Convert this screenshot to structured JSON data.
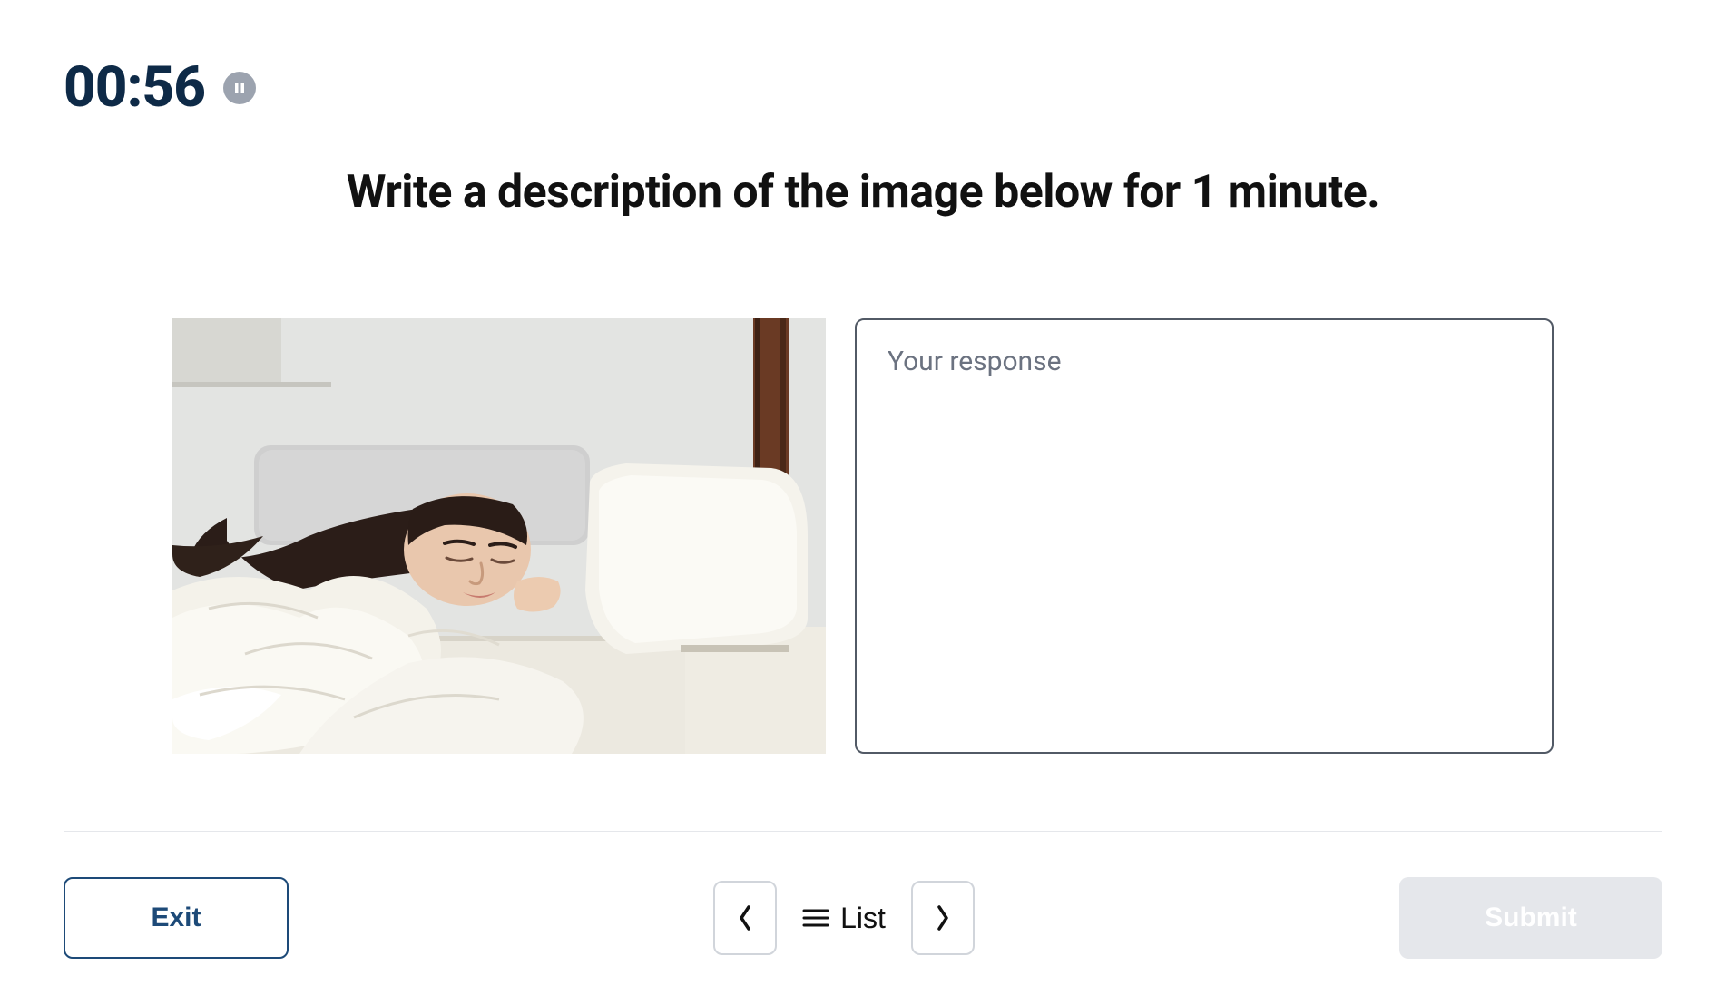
{
  "timer": {
    "value": "00:56"
  },
  "prompt": "Write a description of the image below for 1 minute.",
  "response": {
    "placeholder": "Your response",
    "value": ""
  },
  "footer": {
    "exit_label": "Exit",
    "list_label": "List",
    "submit_label": "Submit"
  }
}
